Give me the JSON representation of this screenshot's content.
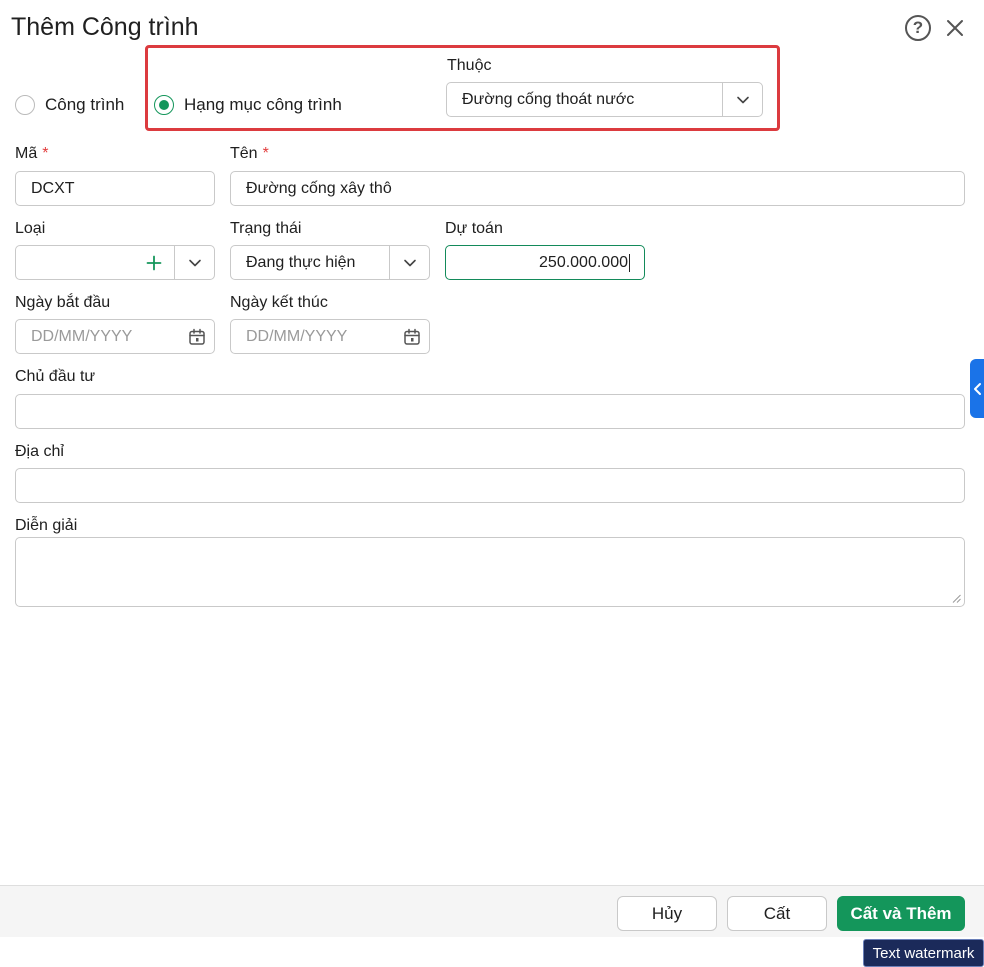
{
  "dialog": {
    "title": "Thêm Công trình"
  },
  "type_selector": {
    "options": [
      {
        "label": "Công trình",
        "selected": false
      },
      {
        "label": "Hạng mục công trình",
        "selected": true
      }
    ]
  },
  "parent": {
    "label": "Thuộc",
    "value": "Đường cống thoát nước"
  },
  "fields": {
    "code": {
      "label": "Mã",
      "required_mark": "*",
      "value": "DCXT"
    },
    "name": {
      "label": "Tên",
      "required_mark": "*",
      "value": "Đường cống xây thô"
    },
    "type": {
      "label": "Loại",
      "value": ""
    },
    "status": {
      "label": "Trạng thái",
      "value": "Đang thực hiện"
    },
    "estimate": {
      "label": "Dự toán",
      "value": "250.000.000"
    },
    "start_date": {
      "label": "Ngày bắt đầu",
      "placeholder": "DD/MM/YYYY"
    },
    "end_date": {
      "label": "Ngày kết thúc",
      "placeholder": "DD/MM/YYYY"
    },
    "investor": {
      "label": "Chủ đầu tư",
      "value": ""
    },
    "address": {
      "label": "Địa chỉ",
      "value": ""
    },
    "description": {
      "label": "Diễn giải",
      "value": ""
    }
  },
  "footer": {
    "cancel_label": "Hủy",
    "save_label": "Cất",
    "save_add_label": "Cất và Thêm"
  },
  "watermark": "Text watermark",
  "colors": {
    "accent": "#14965b",
    "highlight": "#dc3b3f",
    "side_tab": "#1a73e8"
  }
}
